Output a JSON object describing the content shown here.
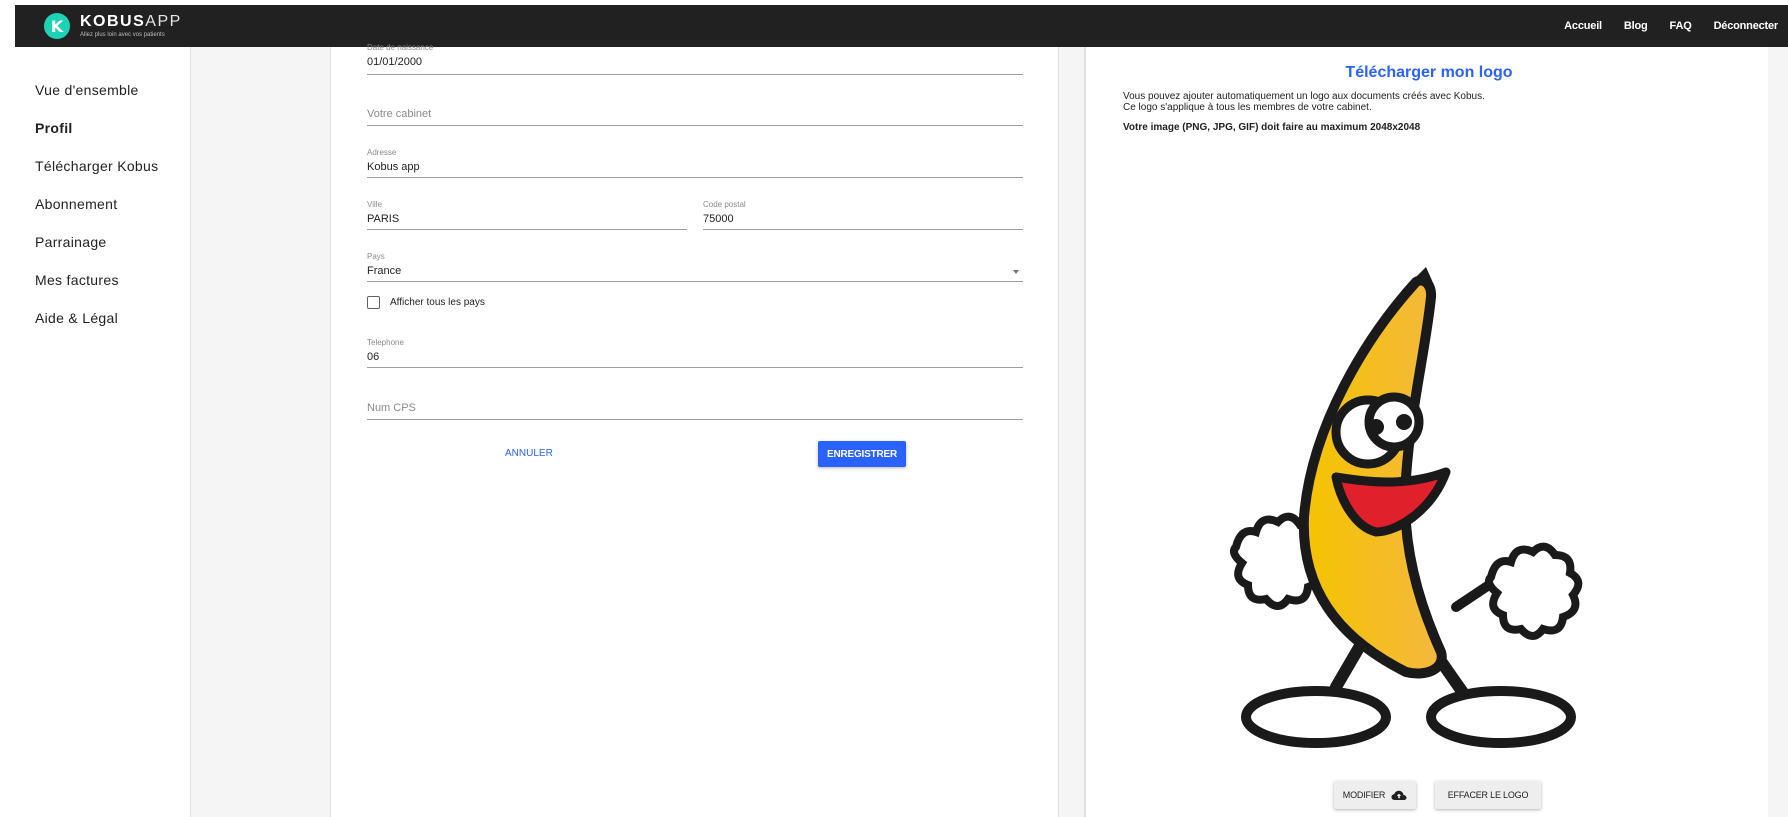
{
  "brand": {
    "logo_letter": "K",
    "name_bold": "KOBUS",
    "name_light": "APP",
    "tagline": "Allez plus loin avec vos patients",
    "color": "#1ed3b5"
  },
  "topnav": {
    "items": [
      "Accueil",
      "Blog",
      "FAQ",
      "Déconnecter"
    ]
  },
  "sidebar": {
    "items": [
      {
        "label": "Vue d'ensemble",
        "active": false
      },
      {
        "label": "Profil",
        "active": true
      },
      {
        "label": "Télécharger Kobus",
        "active": false
      },
      {
        "label": "Abonnement",
        "active": false
      },
      {
        "label": "Parrainage",
        "active": false
      },
      {
        "label": "Mes factures",
        "active": false
      },
      {
        "label": "Aide & Légal",
        "active": false
      }
    ]
  },
  "form": {
    "birthdate": {
      "label": "Date de naissance",
      "value": "01/01/2000"
    },
    "cabinet": {
      "placeholder": "Votre cabinet"
    },
    "address": {
      "label": "Adresse",
      "value": "Kobus app"
    },
    "city": {
      "label": "Ville",
      "value": "PARIS"
    },
    "postal_code": {
      "label": "Code postal",
      "value": "75000"
    },
    "country": {
      "label": "Pays",
      "value": "France"
    },
    "show_all_countries": {
      "label": "Afficher tous les pays",
      "checked": false
    },
    "phone": {
      "label": "Telephone",
      "value": "06"
    },
    "cps": {
      "placeholder": "Num CPS"
    },
    "cancel_label": "ANNULER",
    "save_label": "ENREGISTRER",
    "accent": "#2962ff"
  },
  "logo_panel": {
    "title": "Télécharger mon logo",
    "desc_line1": "Vous pouvez ajouter automatiquement un logo aux documents créés avec Kobus.",
    "desc_line2": "Ce logo s'applique à tous les membres de votre cabinet.",
    "requirement": "Votre image (PNG, JPG, GIF) doit faire au maximum 2048x2048",
    "image_icon": "dancing-banana-logo",
    "modify_label": "MODIFIER",
    "modify_icon": "cloud-upload-icon",
    "clear_label": "EFFACER LE LOGO"
  }
}
